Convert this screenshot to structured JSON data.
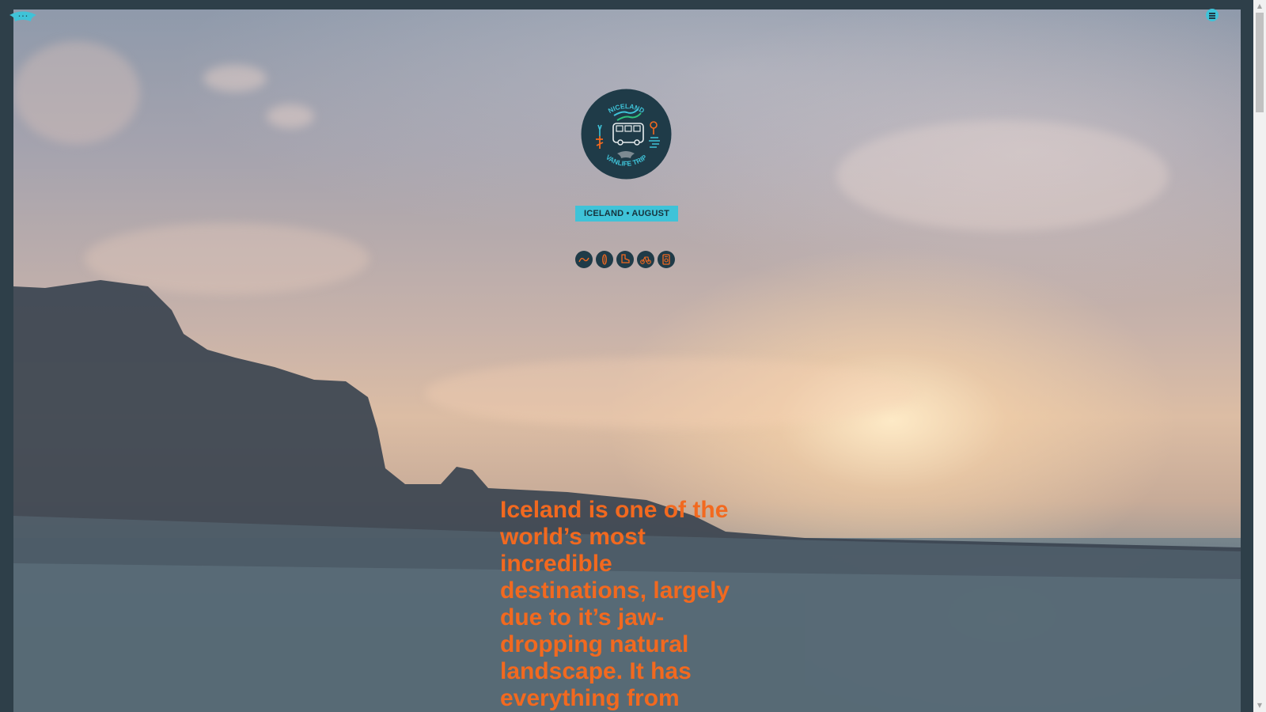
{
  "header": {
    "logo_icon": "witta-logo-icon",
    "menu_icon": "hamburger-menu-icon"
  },
  "badge": {
    "top_text": "NICELAND",
    "bottom_text": "VANLIFE TRIP",
    "center_icon": "van-icon"
  },
  "trip": {
    "tag": "ICELAND • AUGUST"
  },
  "trip_icons": [
    {
      "name": "wave-icon",
      "color": "#f2691f"
    },
    {
      "name": "surfboard-icon",
      "color": "#f2691f"
    },
    {
      "name": "boot-icon",
      "color": "#f2691f"
    },
    {
      "name": "bike-icon",
      "color": "#f2691f"
    },
    {
      "name": "camera-icon",
      "color": "#f2691f"
    }
  ],
  "main": {
    "headline": "Iceland is one of the world’s most incredible destinations, largely due to it’s jaw-dropping natural landscape. It has everything from"
  },
  "colors": {
    "accent_cyan": "#3fc3d8",
    "headline_orange": "#f2691f",
    "frame": "#2e3f49"
  },
  "scrollbar": {
    "up_arrow": "▲",
    "down_arrow": "▼"
  }
}
